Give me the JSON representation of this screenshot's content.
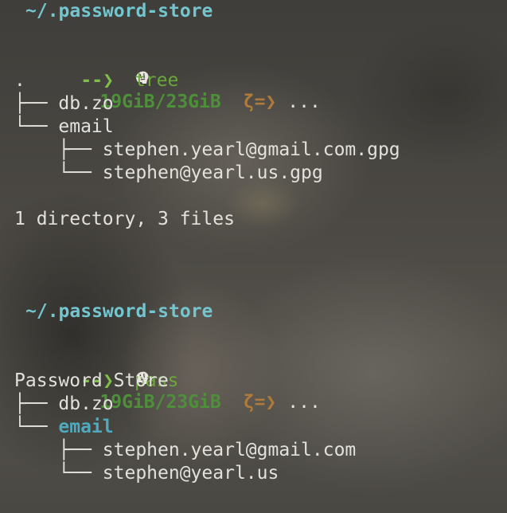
{
  "blocks": [
    {
      "cwd": "~/.password-store",
      "memory": "19GiB/23GiB",
      "git_symbol": "ζ=❯",
      "ellipsis": "...",
      "arrow": "--❯",
      "command": "tree",
      "output": {
        "root": ".",
        "items": [
          {
            "prefix": "├── ",
            "name": "db.zo"
          },
          {
            "prefix": "└── ",
            "name": "email"
          },
          {
            "prefix": "    ├── ",
            "name": "stephen.yearl@gmail.com.gpg"
          },
          {
            "prefix": "    └── ",
            "name": "stephen@yearl.us.gpg"
          }
        ],
        "summary": "1 directory, 3 files"
      }
    },
    {
      "cwd": "~/.password-store",
      "memory": "19GiB/23GiB",
      "git_symbol": "ζ=❯",
      "ellipsis": "...",
      "arrow": "--❯",
      "command": "pass",
      "output": {
        "root": "Password Store",
        "items": [
          {
            "prefix": "├── ",
            "name": "db.zo"
          },
          {
            "prefix": "└── ",
            "name": "email"
          },
          {
            "prefix": "    ├── ",
            "name": "stephen.yearl@gmail.com"
          },
          {
            "prefix": "    └── ",
            "name": "stephen@yearl.us"
          }
        ]
      }
    }
  ],
  "icons": {
    "memory": "brain-icon"
  },
  "colors": {
    "cwd": "#73c5ce",
    "memory": "#4e8f3a",
    "git": "#b07a3a",
    "arrow": "#7fbf45",
    "command": "#6aa83a",
    "directory": "#4fa9bf",
    "text": "#e3e1dc"
  }
}
